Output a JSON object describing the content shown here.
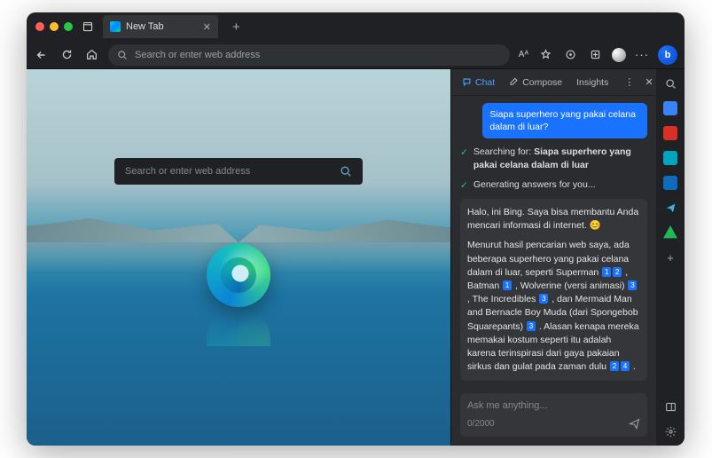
{
  "tab": {
    "title": "New Tab"
  },
  "addressbar": {
    "placeholder": "Search or enter web address"
  },
  "toolbar_right": {
    "aA": "Aᴬ",
    "bing_badge": "b"
  },
  "ntp": {
    "search_placeholder": "Search or enter web address"
  },
  "panel": {
    "tabs": {
      "chat": "Chat",
      "compose": "Compose",
      "insights": "Insights"
    },
    "user_message": "Siapa superhero yang pakai celana dalam di luar?",
    "status_searching_prefix": "Searching for: ",
    "status_searching_query": "Siapa superhero yang pakai celana dalam di luar",
    "status_generating": "Generating answers for you...",
    "answer_p1": "Halo, ini Bing. Saya bisa membantu Anda mencari informasi di internet. 😊",
    "answer_p2_a": "Menurut hasil pencarian web saya, ada beberapa superhero yang pakai celana dalam di luar, seperti Superman",
    "answer_p2_b": ", Batman",
    "answer_p2_c": ", Wolverine (versi animasi)",
    "answer_p2_d": ", The Incredibles",
    "answer_p2_e": ", dan Mermaid Man and Bernacle Boy Muda (dari Spongebob Squarepants)",
    "answer_p2_f": ". Alasan kenapa mereka memakai kostum seperti itu adalah karena terinspirasi dari gaya pakaian sirkus dan gulat pada zaman dulu",
    "answer_p2_g": ".",
    "cites": {
      "c1": "1",
      "c2": "2",
      "c3": "3",
      "c4": "4"
    },
    "input_placeholder": "Ask me anything...",
    "char_count": "0/2000"
  }
}
